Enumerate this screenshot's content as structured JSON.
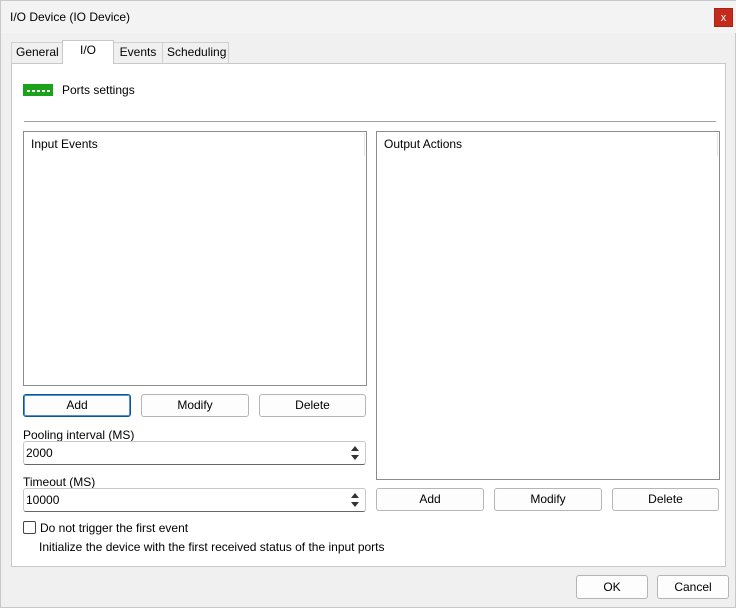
{
  "window": {
    "title": "I/O Device (IO Device)",
    "close_glyph": "x"
  },
  "tabs": [
    {
      "label": "General",
      "active": false
    },
    {
      "label": "I/O",
      "active": true
    },
    {
      "label": "Events",
      "active": false
    },
    {
      "label": "Scheduling",
      "active": false
    }
  ],
  "ports": {
    "icon": "ports-icon",
    "label": "Ports settings"
  },
  "input_events": {
    "header": "Input Events",
    "items": [],
    "buttons": {
      "add": "Add",
      "modify": "Modify",
      "delete": "Delete"
    }
  },
  "output_actions": {
    "header": "Output Actions",
    "items": [],
    "buttons": {
      "add": "Add",
      "modify": "Modify",
      "delete": "Delete"
    }
  },
  "pooling": {
    "label": "Pooling interval (MS)",
    "value": "2000"
  },
  "timeout": {
    "label": "Timeout (MS)",
    "value": "10000"
  },
  "first_event": {
    "checked": false,
    "label": "Do not trigger the first event",
    "description": "Initialize the device with the first received status of the input ports"
  },
  "footer": {
    "ok": "OK",
    "cancel": "Cancel"
  },
  "colors": {
    "ports_icon": "#1aa31a",
    "close_button": "#c42b1c"
  }
}
